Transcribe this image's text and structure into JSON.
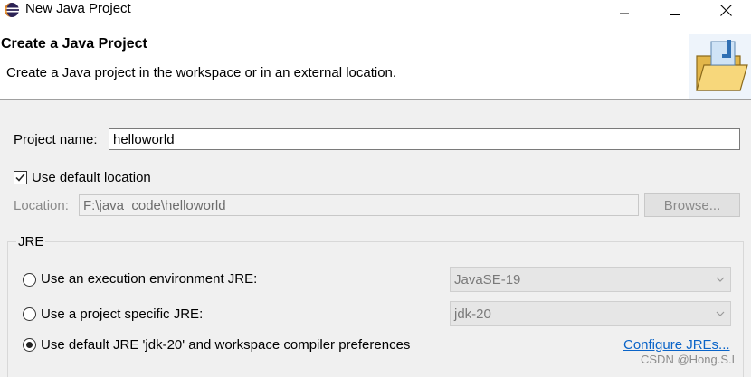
{
  "window": {
    "title": "New Java Project"
  },
  "header": {
    "title": "Create a Java Project",
    "description": "Create a Java project in the workspace or in an external location."
  },
  "project_name": {
    "label": "Project name:",
    "value": "helloworld"
  },
  "default_location": {
    "label": "Use default location",
    "checked": true
  },
  "location": {
    "label": "Location:",
    "value": "F:\\java_code\\helloworld",
    "browse_label": "Browse..."
  },
  "jre": {
    "group_label": "JRE",
    "option_exec_env": "Use an execution environment JRE:",
    "exec_env_value": "JavaSE-19",
    "option_project_specific": "Use a project specific JRE:",
    "project_specific_value": "jdk-20",
    "option_default": "Use default JRE 'jdk-20' and workspace compiler preferences",
    "selected": "default",
    "configure_link": "Configure JREs..."
  },
  "watermark": "CSDN @Hong.S.L",
  "colors": {
    "link": "#0a64c8",
    "header_bg": "#ffffff",
    "dialog_bg": "#f0f0f0"
  }
}
